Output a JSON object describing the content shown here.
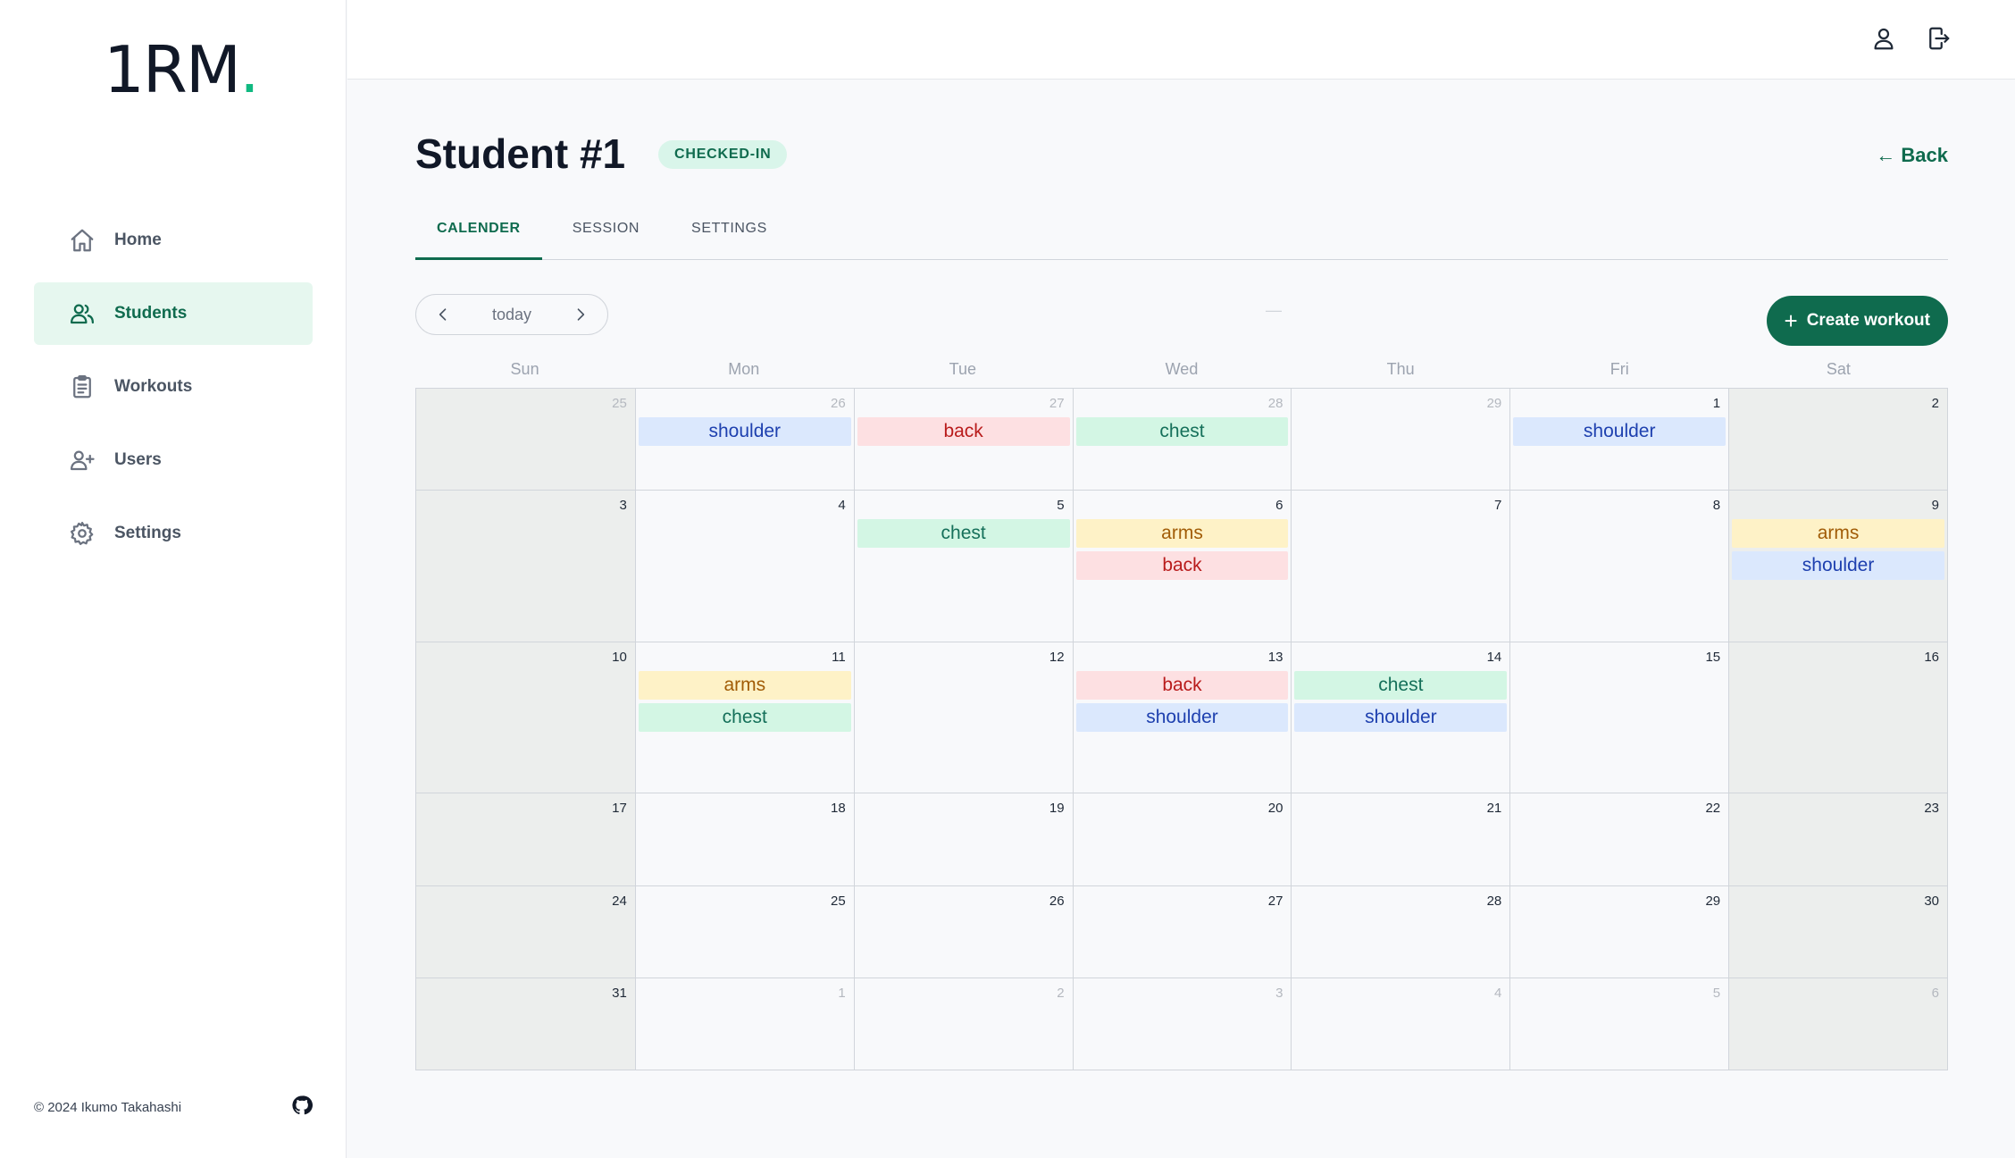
{
  "app": {
    "logo": "1RM",
    "logo_dot": "."
  },
  "sidebar": {
    "items": [
      {
        "label": "Home",
        "icon": "home-icon",
        "active": false
      },
      {
        "label": "Students",
        "icon": "users-icon",
        "active": true
      },
      {
        "label": "Workouts",
        "icon": "clipboard-icon",
        "active": false
      },
      {
        "label": "Users",
        "icon": "user-plus-icon",
        "active": false
      },
      {
        "label": "Settings",
        "icon": "gear-icon",
        "active": false
      }
    ],
    "footer": {
      "copyright": "© 2024 Ikumo Takahashi",
      "icon": "github-icon"
    }
  },
  "topbar": {
    "icons": [
      "user-icon",
      "logout-icon"
    ]
  },
  "header": {
    "title": "Student #1",
    "status": "CHECKED-IN",
    "back_label": "← Back"
  },
  "tabs": [
    {
      "label": "CALENDER",
      "active": true
    },
    {
      "label": "SESSION",
      "active": false
    },
    {
      "label": "SETTINGS",
      "active": false
    }
  ],
  "toolbar": {
    "today_label": "today",
    "title": "—",
    "create_label": "Create workout"
  },
  "calendar": {
    "days_of_week": [
      "Sun",
      "Mon",
      "Tue",
      "Wed",
      "Thu",
      "Fri",
      "Sat"
    ],
    "weeks": [
      {
        "days": [
          {
            "num": "25",
            "other": true,
            "events": []
          },
          {
            "num": "26",
            "other": true,
            "events": [
              "shoulder"
            ]
          },
          {
            "num": "27",
            "other": true,
            "events": [
              "back"
            ]
          },
          {
            "num": "28",
            "other": true,
            "events": [
              "chest"
            ]
          },
          {
            "num": "29",
            "other": true,
            "events": []
          },
          {
            "num": "1",
            "other": false,
            "events": [
              "shoulder"
            ]
          },
          {
            "num": "2",
            "other": false,
            "events": []
          }
        ]
      },
      {
        "days": [
          {
            "num": "3",
            "other": false,
            "events": []
          },
          {
            "num": "4",
            "other": false,
            "events": []
          },
          {
            "num": "5",
            "other": false,
            "events": [
              "chest"
            ]
          },
          {
            "num": "6",
            "other": false,
            "events": [
              "arms",
              "back"
            ]
          },
          {
            "num": "7",
            "other": false,
            "events": []
          },
          {
            "num": "8",
            "other": false,
            "events": []
          },
          {
            "num": "9",
            "other": false,
            "events": [
              "arms",
              "shoulder"
            ]
          }
        ]
      },
      {
        "days": [
          {
            "num": "10",
            "other": false,
            "events": []
          },
          {
            "num": "11",
            "other": false,
            "events": [
              "arms",
              "chest"
            ]
          },
          {
            "num": "12",
            "other": false,
            "events": []
          },
          {
            "num": "13",
            "other": false,
            "events": [
              "back",
              "shoulder"
            ]
          },
          {
            "num": "14",
            "other": false,
            "events": [
              "chest",
              "shoulder"
            ]
          },
          {
            "num": "15",
            "other": false,
            "events": []
          },
          {
            "num": "16",
            "other": false,
            "events": []
          }
        ]
      },
      {
        "days": [
          {
            "num": "17",
            "other": false,
            "events": []
          },
          {
            "num": "18",
            "other": false,
            "events": []
          },
          {
            "num": "19",
            "other": false,
            "events": []
          },
          {
            "num": "20",
            "other": false,
            "events": []
          },
          {
            "num": "21",
            "other": false,
            "events": []
          },
          {
            "num": "22",
            "other": false,
            "events": []
          },
          {
            "num": "23",
            "other": false,
            "events": []
          }
        ]
      },
      {
        "days": [
          {
            "num": "24",
            "other": false,
            "events": []
          },
          {
            "num": "25",
            "other": false,
            "events": []
          },
          {
            "num": "26",
            "other": false,
            "events": []
          },
          {
            "num": "27",
            "other": false,
            "events": []
          },
          {
            "num": "28",
            "other": false,
            "events": []
          },
          {
            "num": "29",
            "other": false,
            "events": []
          },
          {
            "num": "30",
            "other": false,
            "events": []
          }
        ]
      },
      {
        "days": [
          {
            "num": "31",
            "other": false,
            "events": []
          },
          {
            "num": "1",
            "other": true,
            "events": []
          },
          {
            "num": "2",
            "other": true,
            "events": []
          },
          {
            "num": "3",
            "other": true,
            "events": []
          },
          {
            "num": "4",
            "other": true,
            "events": []
          },
          {
            "num": "5",
            "other": true,
            "events": []
          },
          {
            "num": "6",
            "other": true,
            "events": []
          }
        ]
      }
    ]
  },
  "colors": {
    "accent": "#0f6b4e",
    "brand_dot": "#10b981",
    "event_shoulder": "#dbe8fd",
    "event_back": "#fde0e2",
    "event_chest": "#d3f6e4",
    "event_arms": "#fef2c7"
  }
}
